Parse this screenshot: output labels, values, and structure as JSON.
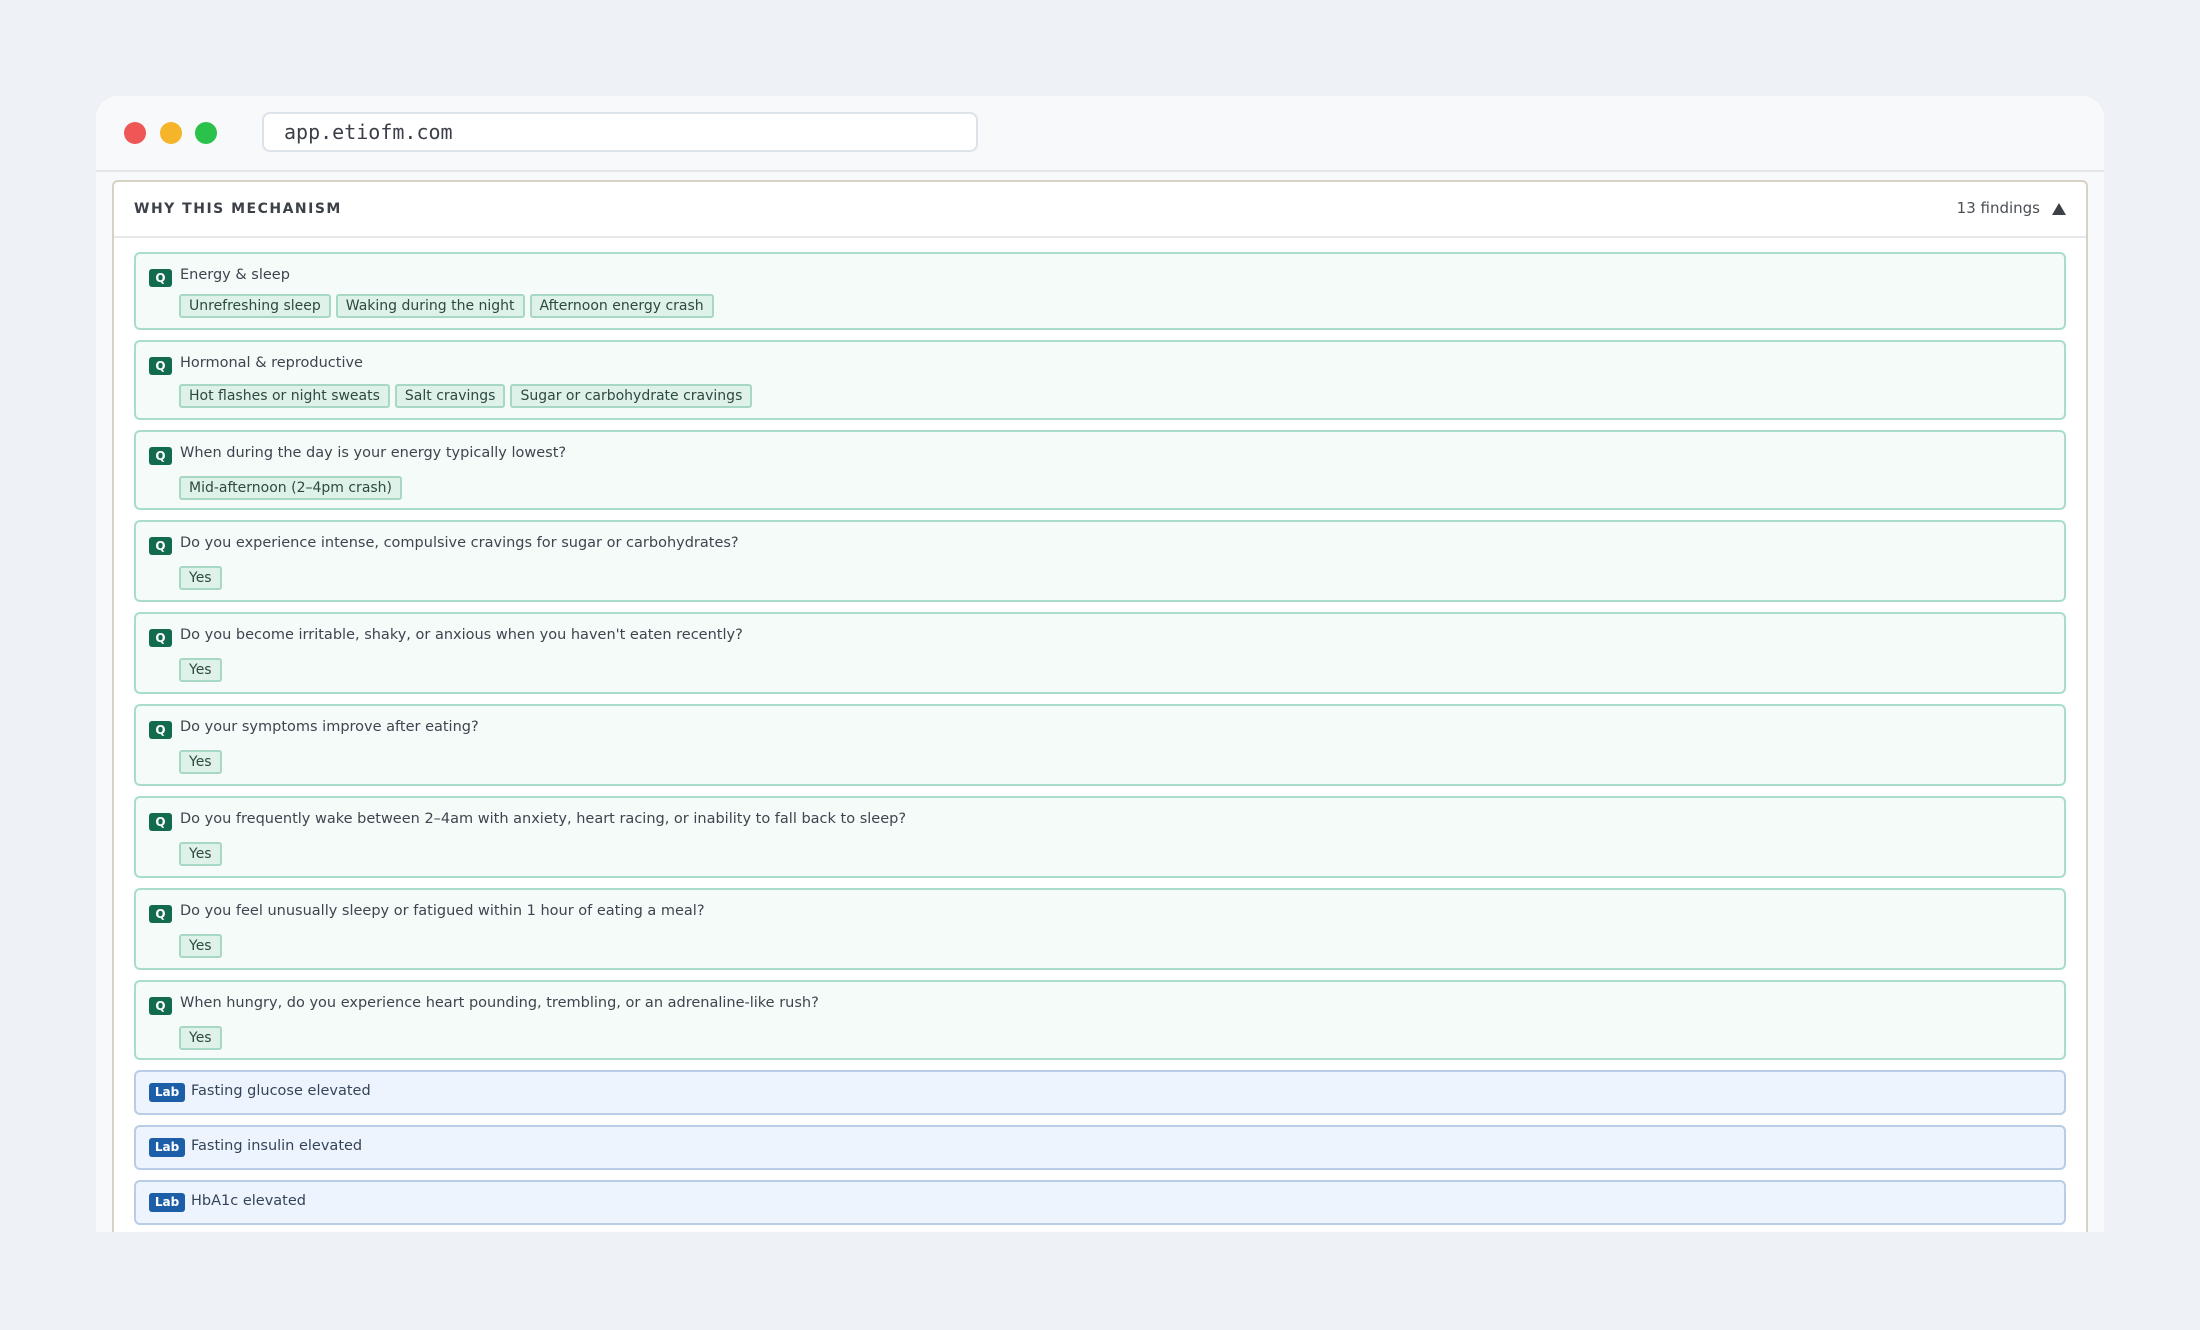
{
  "browser": {
    "url": "app.etiofm.com"
  },
  "panel": {
    "title": "WHY THIS MECHANISM",
    "findings_count": "13 findings"
  },
  "questions": [
    {
      "badge": "Q",
      "text": "Energy & sleep",
      "answers": [
        "Unrefreshing sleep",
        "Waking during the night",
        "Afternoon energy crash"
      ]
    },
    {
      "badge": "Q",
      "text": "Hormonal & reproductive",
      "answers": [
        "Hot flashes or night sweats",
        "Salt cravings",
        "Sugar or carbohydrate cravings"
      ]
    },
    {
      "badge": "Q",
      "text": "When during the day is your energy typically lowest?",
      "answers": [
        "Mid-afternoon (2–4pm crash)"
      ]
    },
    {
      "badge": "Q",
      "text": "Do you experience intense, compulsive cravings for sugar or carbohydrates?",
      "answers": [
        "Yes"
      ]
    },
    {
      "badge": "Q",
      "text": "Do you become irritable, shaky, or anxious when you haven't eaten recently?",
      "answers": [
        "Yes"
      ]
    },
    {
      "badge": "Q",
      "text": "Do your symptoms improve after eating?",
      "answers": [
        "Yes"
      ]
    },
    {
      "badge": "Q",
      "text": "Do you frequently wake between 2–4am with anxiety, heart racing, or inability to fall back to sleep?",
      "answers": [
        "Yes"
      ]
    },
    {
      "badge": "Q",
      "text": "Do you feel unusually sleepy or fatigued within 1 hour of eating a meal?",
      "answers": [
        "Yes"
      ]
    },
    {
      "badge": "Q",
      "text": "When hungry, do you experience heart pounding, trembling, or an adrenaline-like rush?",
      "answers": [
        "Yes"
      ]
    }
  ],
  "labs": [
    {
      "badge": "Lab",
      "text": "Fasting glucose elevated"
    },
    {
      "badge": "Lab",
      "text": "Fasting insulin elevated"
    },
    {
      "badge": "Lab",
      "text": "HbA1c elevated"
    }
  ],
  "colors": {
    "question_badge": "#136b4f",
    "lab_badge": "#1d5ea8",
    "question_card_bg": "#f4fbf8",
    "lab_card_bg": "#eef4fd"
  }
}
